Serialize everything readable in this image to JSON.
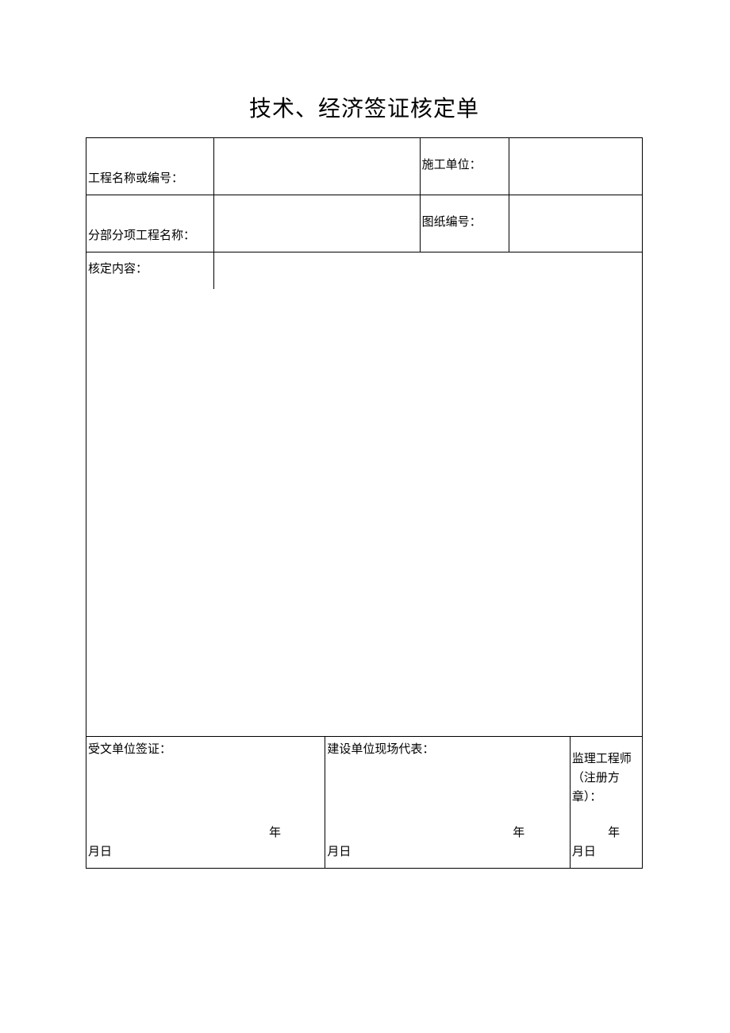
{
  "title": "技术、经济签证核定单",
  "row1": {
    "label_project": "工程名称或编号：",
    "value_project": "",
    "label_contractor": "施工单位：",
    "value_contractor": ""
  },
  "row2": {
    "label_subproject": "分部分项工程名称：",
    "value_subproject": "",
    "label_drawing": "图纸编号：",
    "value_drawing": ""
  },
  "row3": {
    "label_content": "核定内容：",
    "value_content": ""
  },
  "content_body": "",
  "signatures": {
    "recipient": {
      "label": "受文单位签证：",
      "year": "年",
      "monthday": "月日"
    },
    "owner_rep": {
      "label": "建设单位现场代表：",
      "year": "年",
      "monthday": "月日"
    },
    "supervisor": {
      "label": "监理工程师（注册方章）：",
      "year": "年",
      "monthday": "月日"
    }
  }
}
